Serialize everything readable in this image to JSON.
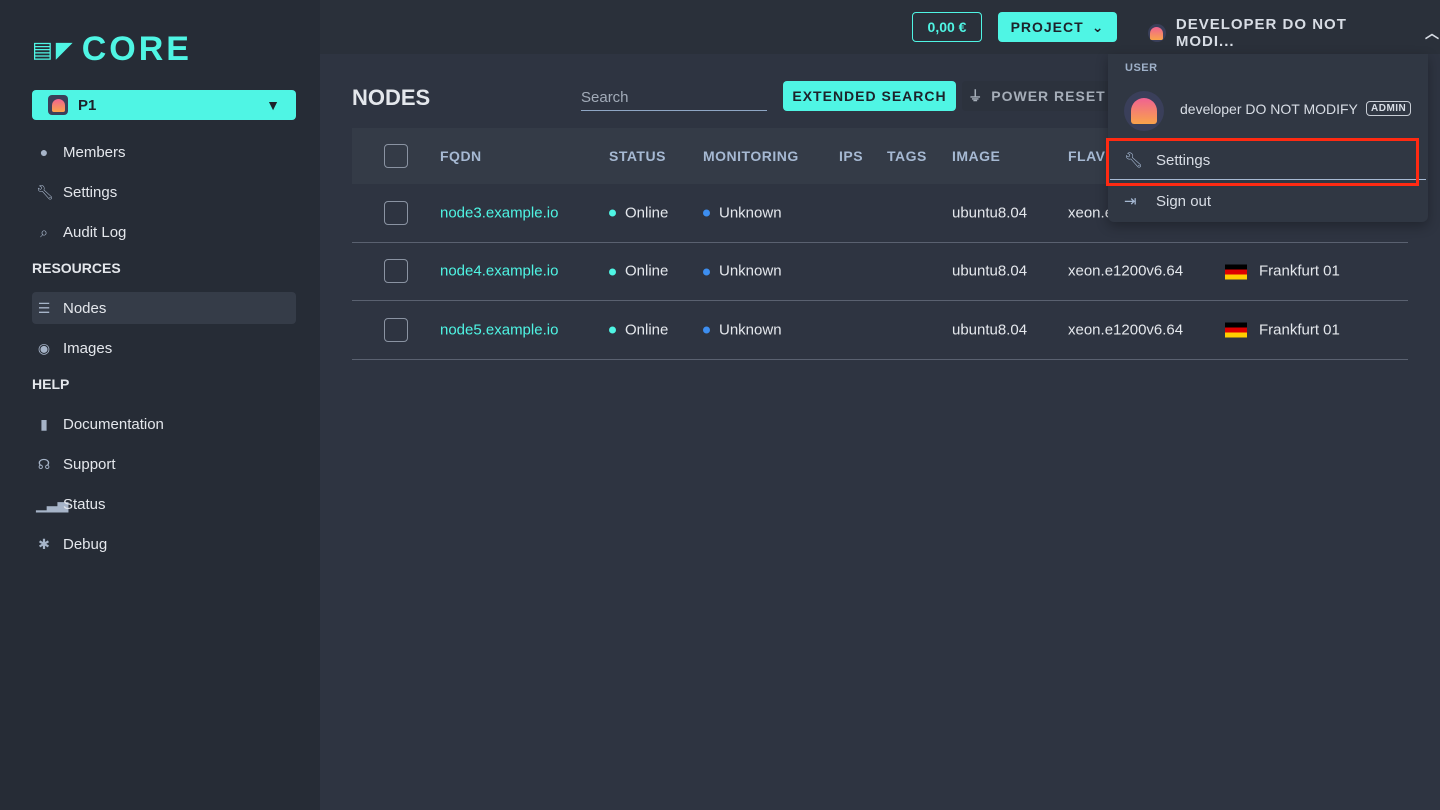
{
  "brand": {
    "logo": "CORE",
    "accent": "#4ff5e4"
  },
  "sidebar": {
    "project": "P1",
    "items": [
      {
        "label": "Members",
        "icon": "user-icon"
      },
      {
        "label": "Settings",
        "icon": "wrench-icon"
      },
      {
        "label": "Audit Log",
        "icon": "search-icon"
      }
    ],
    "resources_title": "RESOURCES",
    "resources": [
      {
        "label": "Nodes",
        "icon": "server-icon",
        "active": true
      },
      {
        "label": "Images",
        "icon": "disc-icon"
      }
    ],
    "help_title": "HELP",
    "help": [
      {
        "label": "Documentation",
        "icon": "book-icon"
      },
      {
        "label": "Support",
        "icon": "headset-icon"
      },
      {
        "label": "Status",
        "icon": "signal-icon"
      },
      {
        "label": "Debug",
        "icon": "bug-icon"
      }
    ]
  },
  "topbar": {
    "balance": "0,00 €",
    "project_label": "PROJECT",
    "user_label": "DEVELOPER DO NOT MODI..."
  },
  "page": {
    "title": "NODES",
    "search_placeholder": "Search",
    "extended_search": "EXTENDED SEARCH",
    "power_reset": "POWER RESET"
  },
  "table": {
    "headers": [
      "FQDN",
      "STATUS",
      "MONITORING",
      "IPS",
      "TAGS",
      "IMAGE",
      "FLAVO"
    ],
    "rows": [
      {
        "fqdn": "node3.example.io",
        "status": "Online",
        "monitoring": "Unknown",
        "image": "ubuntu8.04",
        "flavor": "xeon.e",
        "location": ""
      },
      {
        "fqdn": "node4.example.io",
        "status": "Online",
        "monitoring": "Unknown",
        "image": "ubuntu8.04",
        "flavor": "xeon.e1200v6.64",
        "location": "Frankfurt 01"
      },
      {
        "fqdn": "node5.example.io",
        "status": "Online",
        "monitoring": "Unknown",
        "image": "ubuntu8.04",
        "flavor": "xeon.e1200v6.64",
        "location": "Frankfurt 01"
      }
    ]
  },
  "user_menu": {
    "section": "USER",
    "name": "developer DO NOT MODIFY",
    "badge": "ADMIN",
    "settings": "Settings",
    "signout": "Sign out"
  }
}
